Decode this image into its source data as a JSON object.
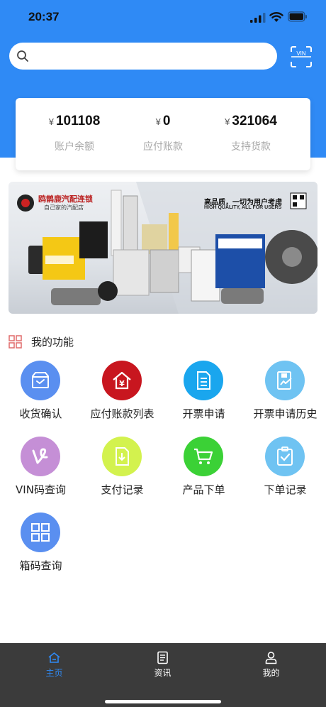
{
  "status_bar": {
    "time": "20:37"
  },
  "search": {
    "placeholder": "",
    "value": ""
  },
  "vin_button": {
    "label": "VIN"
  },
  "balances": [
    {
      "currency": "¥",
      "amount": "101108",
      "label": "账户余额"
    },
    {
      "currency": "¥",
      "amount": "0",
      "label": "应付账款"
    },
    {
      "currency": "¥",
      "amount": "321064",
      "label": "支持货款"
    }
  ],
  "banner": {
    "brand": "鸥鹊鹿汽配连锁",
    "brand_sub": "自己家的汽配店",
    "slogan": "高品质，一切为用户考虑",
    "slogan_en": "HIGH QUALITY, ALL FOR USERS"
  },
  "functions": {
    "title": "我的功能",
    "items": [
      {
        "label": "收货确认",
        "icon": "inbox-check-icon",
        "color": "#5a8ff0"
      },
      {
        "label": "应付账款列表",
        "icon": "house-yen-icon",
        "color": "#c8161f"
      },
      {
        "label": "开票申请",
        "icon": "document-icon",
        "color": "#1aa6ee"
      },
      {
        "label": "开票申请历史",
        "icon": "chart-document-icon",
        "color": "#6fc3f2"
      },
      {
        "label": "VIN码查询",
        "icon": "vine-v-icon",
        "color": "#c58fd6"
      },
      {
        "label": "支付记录",
        "icon": "download-document-icon",
        "color": "#d3f24e"
      },
      {
        "label": "产品下单",
        "icon": "cart-icon",
        "color": "#3bd136"
      },
      {
        "label": "下单记录",
        "icon": "clipboard-check-icon",
        "color": "#6fc3f2"
      },
      {
        "label": "箱码查询",
        "icon": "grid-icon",
        "color": "#5a8ff0"
      }
    ]
  },
  "tab_bar": {
    "active": "主页",
    "tabs": [
      {
        "label": "主页",
        "icon": "home-icon"
      },
      {
        "label": "资讯",
        "icon": "news-icon"
      },
      {
        "label": "我的",
        "icon": "user-icon"
      }
    ]
  },
  "colors": {
    "primary": "#2f8af5",
    "tab_bg": "#3b3b3b"
  }
}
